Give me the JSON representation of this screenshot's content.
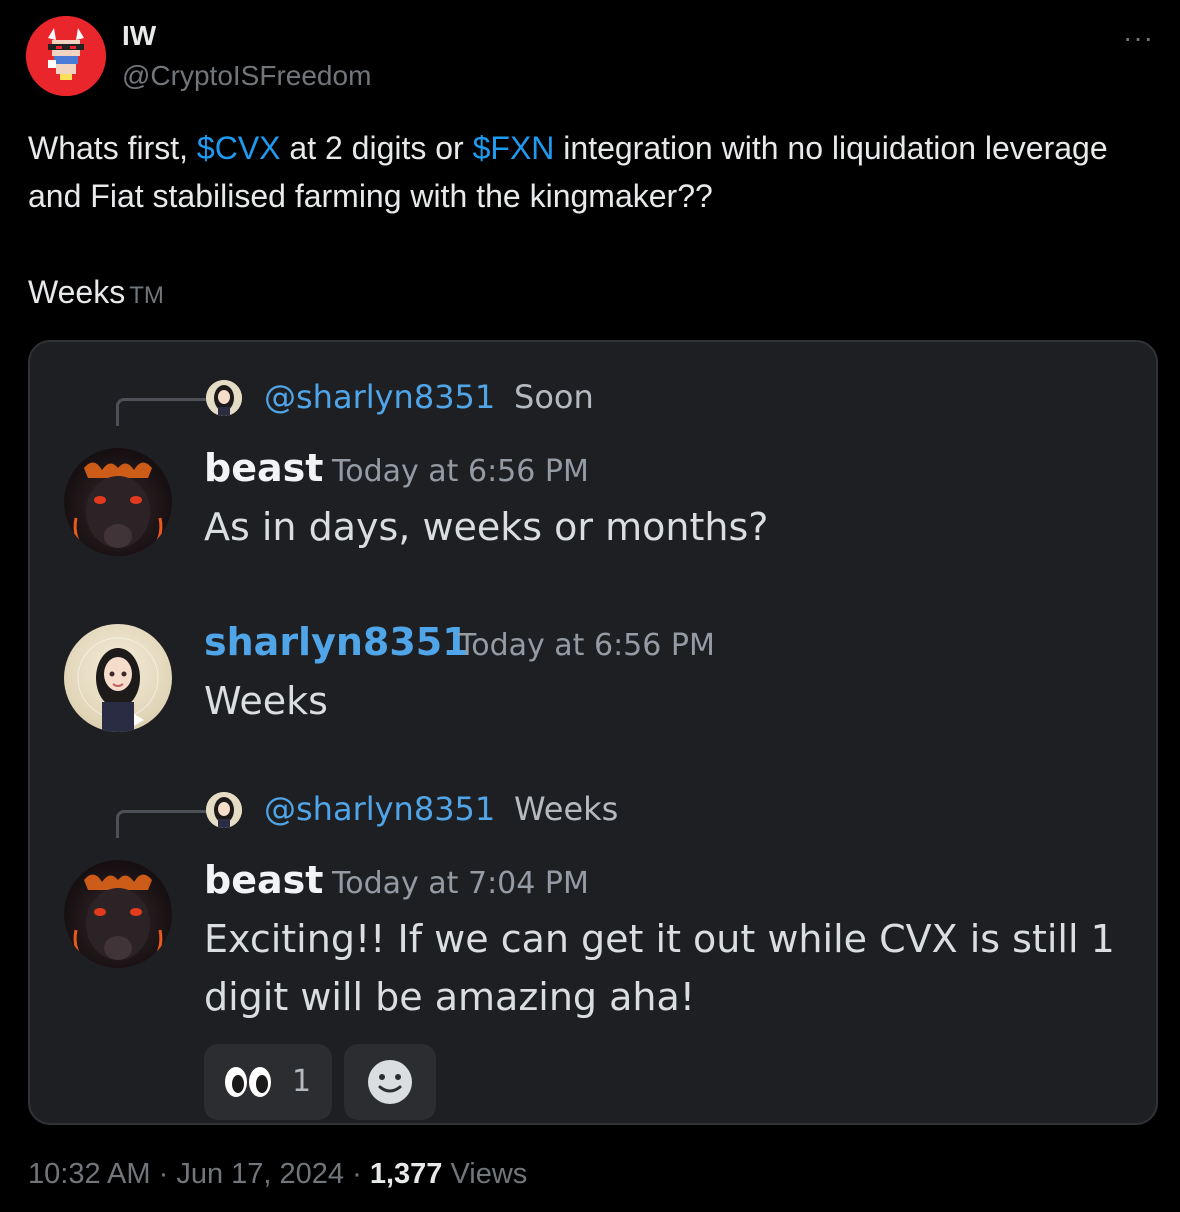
{
  "tweet": {
    "display_name": "IW",
    "handle": "@CryptoISFreedom",
    "more_label": "···",
    "text_segments": [
      {
        "text": "Whats first, ",
        "type": "plain"
      },
      {
        "text": "$CVX",
        "type": "cashtag"
      },
      {
        "text": " at 2 digits or ",
        "type": "plain"
      },
      {
        "text": "$FXN",
        "type": "cashtag"
      },
      {
        "text": " integration with no liquidation leverage and Fiat stabilised farming with the kingmaker??",
        "type": "plain"
      }
    ],
    "line2": "Weeks",
    "line2_suffix": "TM",
    "time": "10:32 AM",
    "date": "Jun 17, 2024",
    "separator": "·",
    "views_count": "1,377",
    "views_label": "Views",
    "cashtag_color": "#1d9bf0"
  },
  "discord": {
    "messages": [
      {
        "reply_mention": "@sharlyn8351",
        "reply_text": "Soon",
        "author": "beast",
        "timestamp": "Today at 6:56 PM",
        "body": "As in days, weeks or months?"
      },
      {
        "author": "sharlyn8351",
        "timestamp": "Today at 6:56 PM",
        "body": "Weeks"
      },
      {
        "reply_mention": "@sharlyn8351",
        "reply_text": "Weeks",
        "author": "beast",
        "timestamp": "Today at 7:04 PM",
        "body_line1": "Exciting!! If we can get it out while CVX is still 1",
        "body_line2": "digit will be amazing aha!"
      }
    ],
    "reaction": {
      "icon": "eyes-emoji-icon",
      "count": "1"
    },
    "add_reaction_icon": "smiley-face-icon",
    "mention_color": "#4fa5e8"
  }
}
